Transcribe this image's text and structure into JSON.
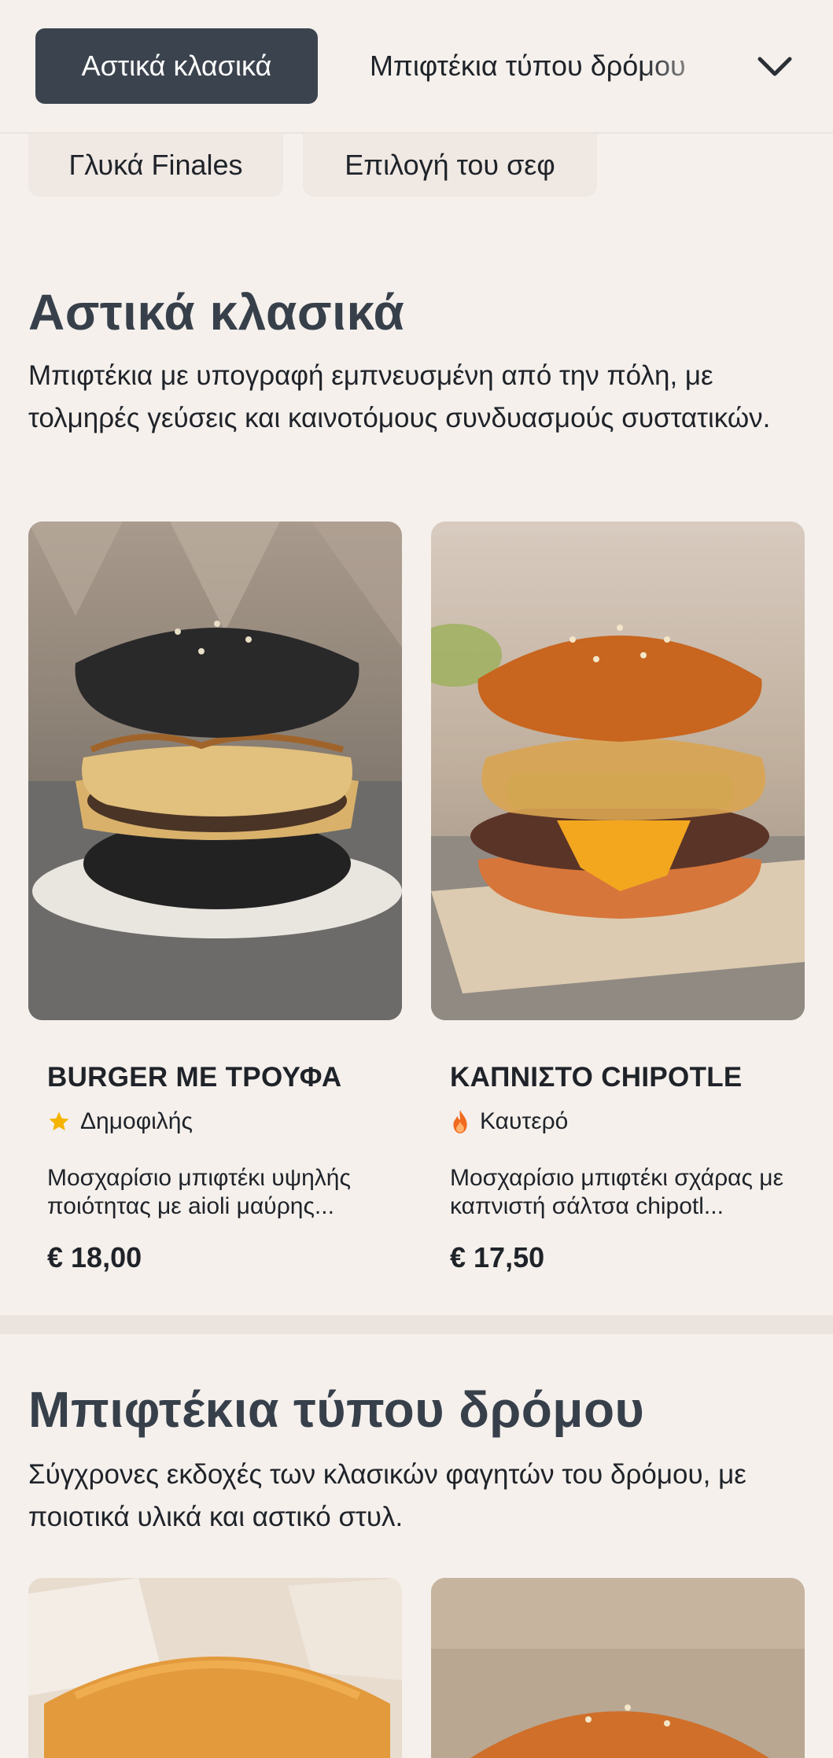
{
  "nav": {
    "active_category": "Αστικά κλασικά",
    "next_category": "Μπιφτέκια τύπου δρόμου",
    "expand_icon": "chevron-down-icon",
    "more_categories": [
      "Γλυκά Finales",
      "Επιλογή του σεφ"
    ]
  },
  "sections": [
    {
      "title": "Αστικά κλασικά",
      "description": "Μπιφτέκια με υπογραφή εμπνευσμένη από την πόλη, με τολμηρές γεύσεις και καινοτόμους συνδυασμούς συστατικών.",
      "items": [
        {
          "name": "BURGER ΜΕ ΤΡΟΥΦΑ",
          "badge": "Δημοφιλής",
          "badge_icon": "star-icon",
          "badge_color": "#f5b400",
          "description": "Μοσχαρίσιο μπιφτέκι υψηλής ποιότητας με aioli μαύρης...",
          "price": "€ 18,00"
        },
        {
          "name": "ΚΑΠΝΙΣΤΟ CHIPOTLE",
          "badge": "Καυτερό",
          "badge_icon": "flame-icon",
          "badge_color": "#f06a1f",
          "description": "Μοσχαρίσιο μπιφτέκι σχάρας με καπνιστή σάλτσα chipotl...",
          "price": "€ 17,50"
        }
      ]
    },
    {
      "title": "Μπιφτέκια τύπου δρόμου",
      "description": "Σύγχρονες εκδοχές των κλασικών φαγητών του δρόμου, με ποιοτικά υλικά και αστικό στυλ."
    }
  ],
  "colors": {
    "background": "#f5f0ec",
    "active_pill": "#3b444e",
    "heading": "#37404a"
  }
}
